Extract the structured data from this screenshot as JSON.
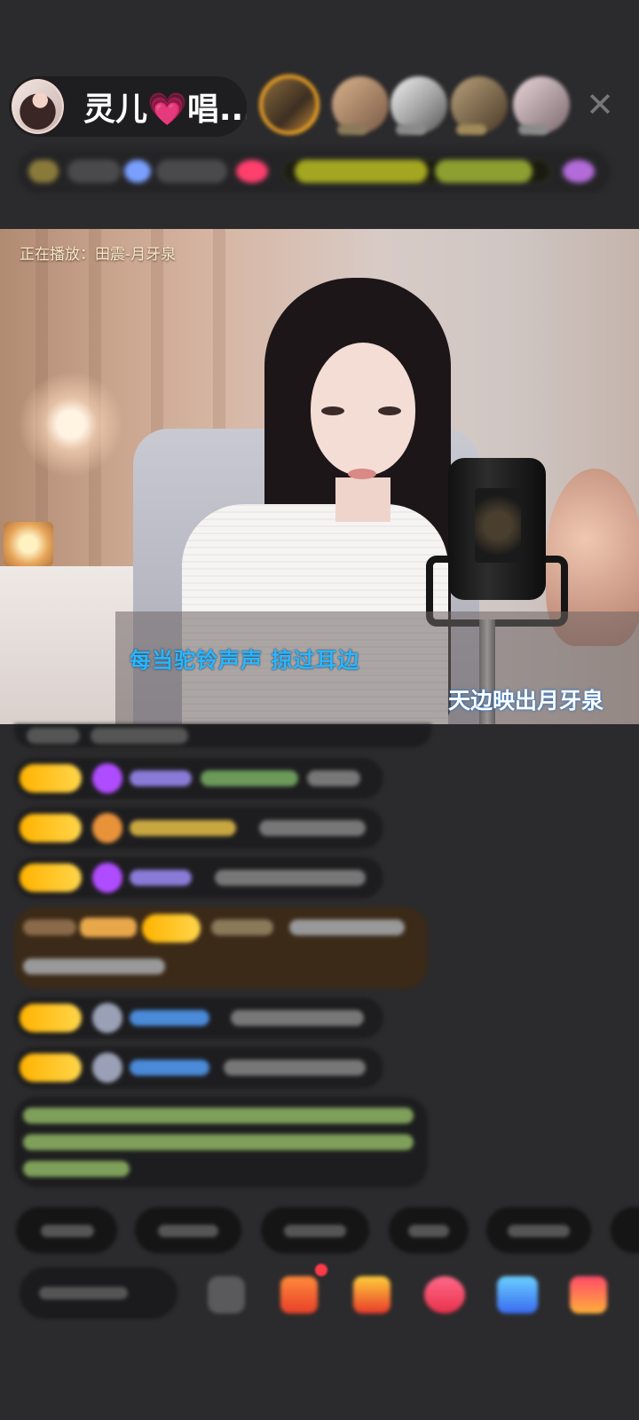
{
  "host": {
    "name_prefix": "灵儿",
    "heart": "💗",
    "name_suffix": "唱..."
  },
  "top_bar": {
    "close_symbol": "✕"
  },
  "video": {
    "now_playing": "正在播放：田震-月牙泉",
    "lyric_line_1": "每当驼铃声声  掠过耳边",
    "lyric_line_2": "天边映出月牙泉"
  },
  "colors": {
    "lyric_primary": "#29b6ff",
    "level_badge": "#ffb300",
    "accent_pink": "#ff4fa6",
    "chat_bubble": "#1d1d1f",
    "page_background": "#2b2b2d"
  },
  "icons": {
    "close": "close-icon",
    "emoji": "emoji-icon",
    "gift_box": "gift-box-icon",
    "red_envelope": "red-envelope-icon",
    "heart_gift": "heart-gift-icon",
    "game": "game-controller-icon",
    "more": "more-icon"
  }
}
